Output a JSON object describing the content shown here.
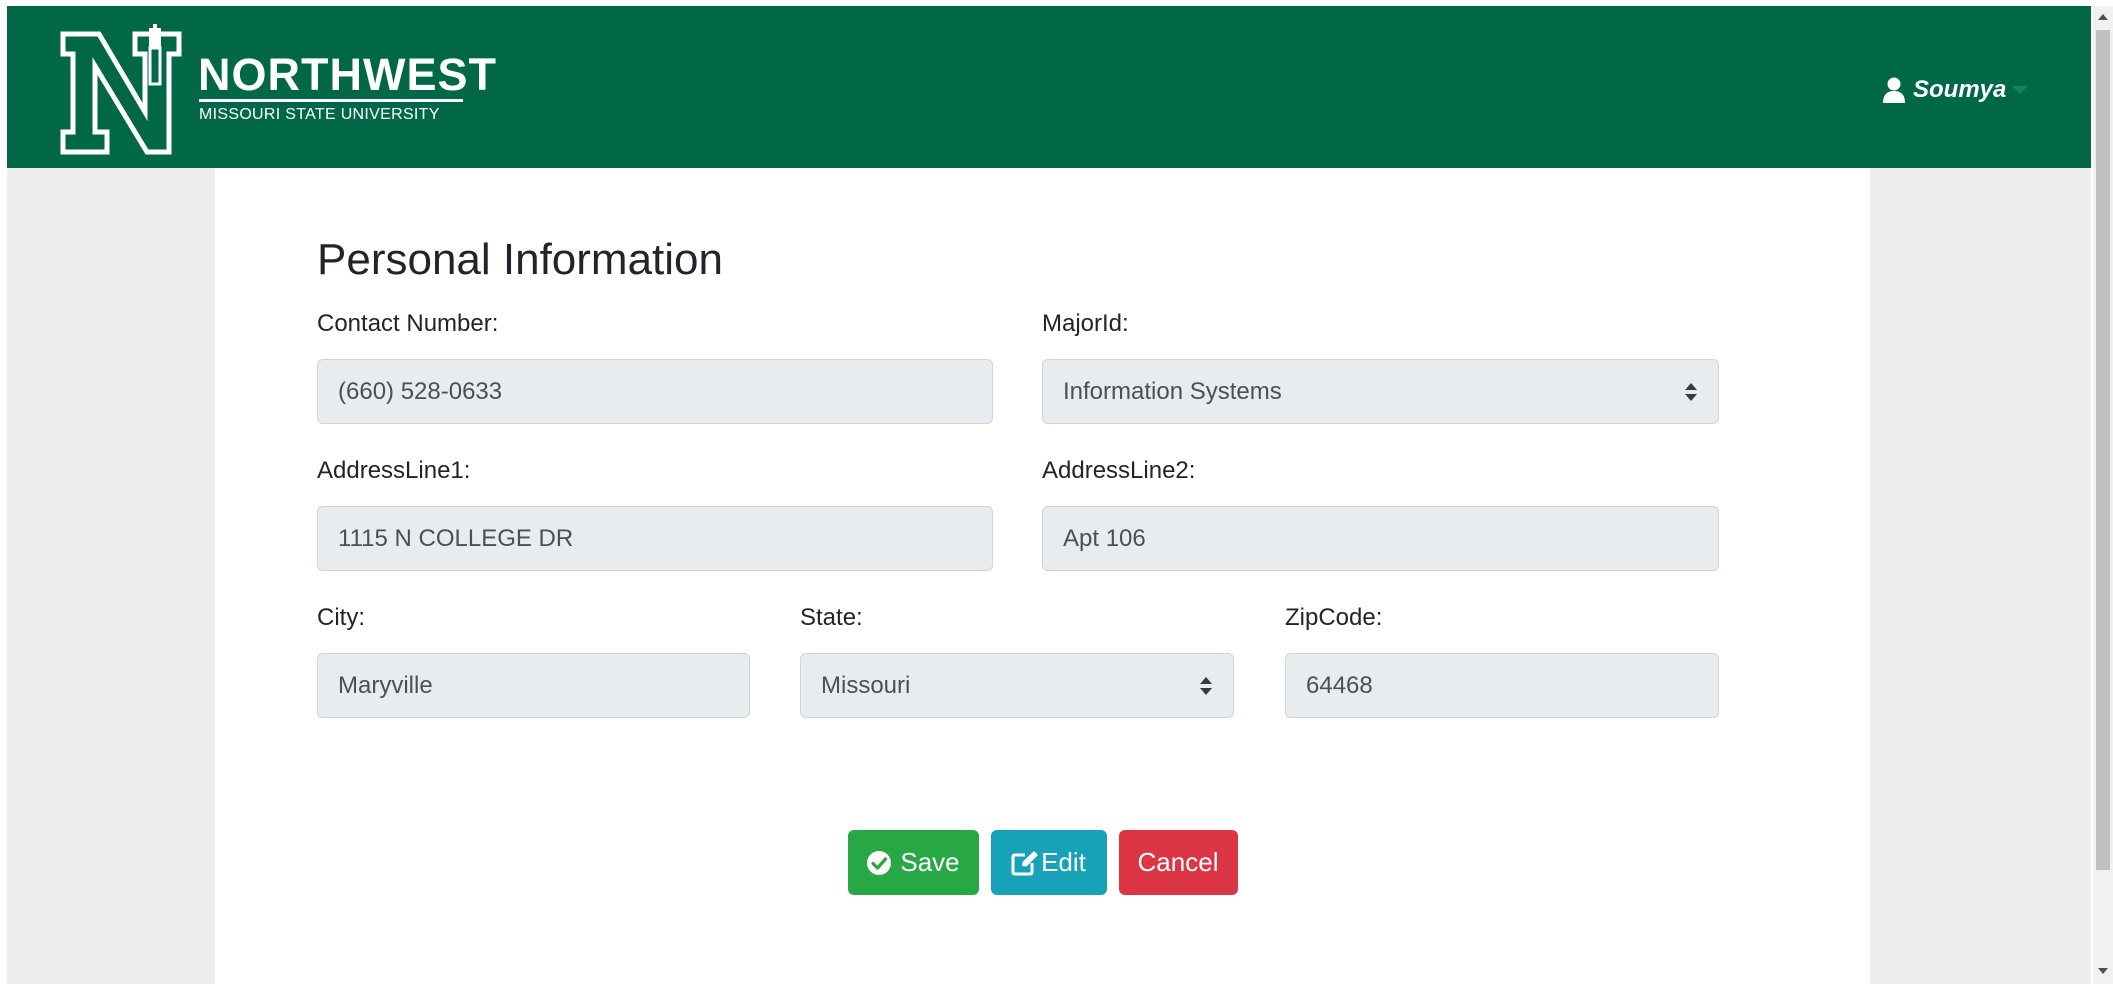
{
  "brand": {
    "name": "NORTHWEST",
    "subtitle": "MISSOURI STATE UNIVERSITY",
    "logo_icon": "northwest-n-bell-tower-logo",
    "color": "#006747"
  },
  "user": {
    "name": "Soumya",
    "icon": "user-icon"
  },
  "form": {
    "title": "Personal Information",
    "contact": {
      "label": "Contact Number:",
      "value": "(660) 528-0633"
    },
    "major": {
      "label": "MajorId:",
      "value": "Information Systems"
    },
    "address1": {
      "label": "AddressLine1:",
      "value": "1115 N COLLEGE DR"
    },
    "address2": {
      "label": "AddressLine2:",
      "value": "Apt 106"
    },
    "city": {
      "label": "City:",
      "value": "Maryville"
    },
    "state": {
      "label": "State:",
      "value": "Missouri"
    },
    "zip": {
      "label": "ZipCode:",
      "value": "64468"
    }
  },
  "buttons": {
    "save": {
      "label": "Save",
      "icon": "check-circle-icon",
      "color": "#28a745"
    },
    "edit": {
      "label": "Edit",
      "icon": "edit-icon",
      "color": "#17a2b8"
    },
    "cancel": {
      "label": "Cancel",
      "color": "#dc3545"
    }
  }
}
